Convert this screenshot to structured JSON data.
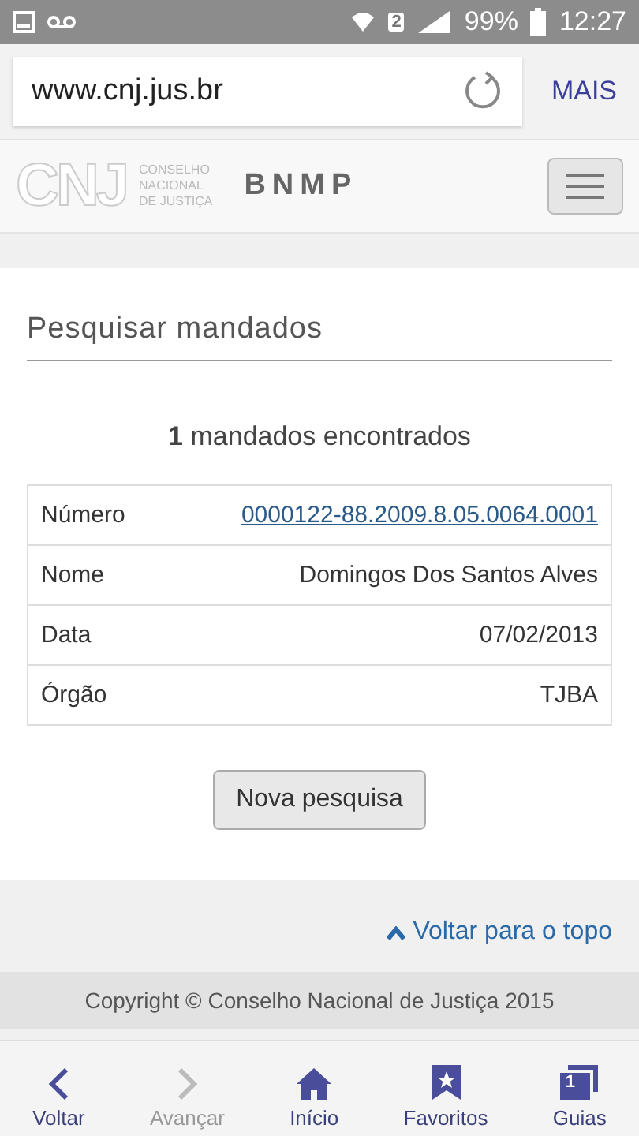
{
  "status_bar": {
    "sim": "2",
    "battery": "99%",
    "time": "12:27"
  },
  "browser": {
    "url": "www.cnj.jus.br",
    "menu": "MAIS"
  },
  "site_header": {
    "logo": "CNJ",
    "org": [
      "CONSELHO",
      "NACIONAL",
      "DE JUSTIÇA"
    ],
    "title": "BNMP"
  },
  "search": {
    "heading": "Pesquisar mandados",
    "result_count": "1",
    "result_text": "mandados encontrados",
    "rows": [
      {
        "label": "Número",
        "value": "0000122-88.2009.8.05.0064.0001",
        "kind": "link"
      },
      {
        "label": "Nome",
        "value": "Domingos Dos Santos Alves",
        "kind": "text"
      },
      {
        "label": "Data",
        "value": "07/02/2013",
        "kind": "text"
      },
      {
        "label": "Órgão",
        "value": "TJBA",
        "kind": "text"
      }
    ],
    "button": "Nova pesquisa"
  },
  "back_to_top": "Voltar para o topo",
  "footer": "Copyright © Conselho Nacional de Justiça 2015",
  "bottom_nav": [
    {
      "label": "Voltar",
      "kind": "back",
      "disabled": false
    },
    {
      "label": "Avançar",
      "kind": "forward",
      "disabled": true
    },
    {
      "label": "Início",
      "kind": "home",
      "disabled": false
    },
    {
      "label": "Favoritos",
      "kind": "bookmark",
      "disabled": false
    },
    {
      "label": "Guias",
      "kind": "tabs",
      "disabled": false,
      "badge": "1"
    }
  ]
}
